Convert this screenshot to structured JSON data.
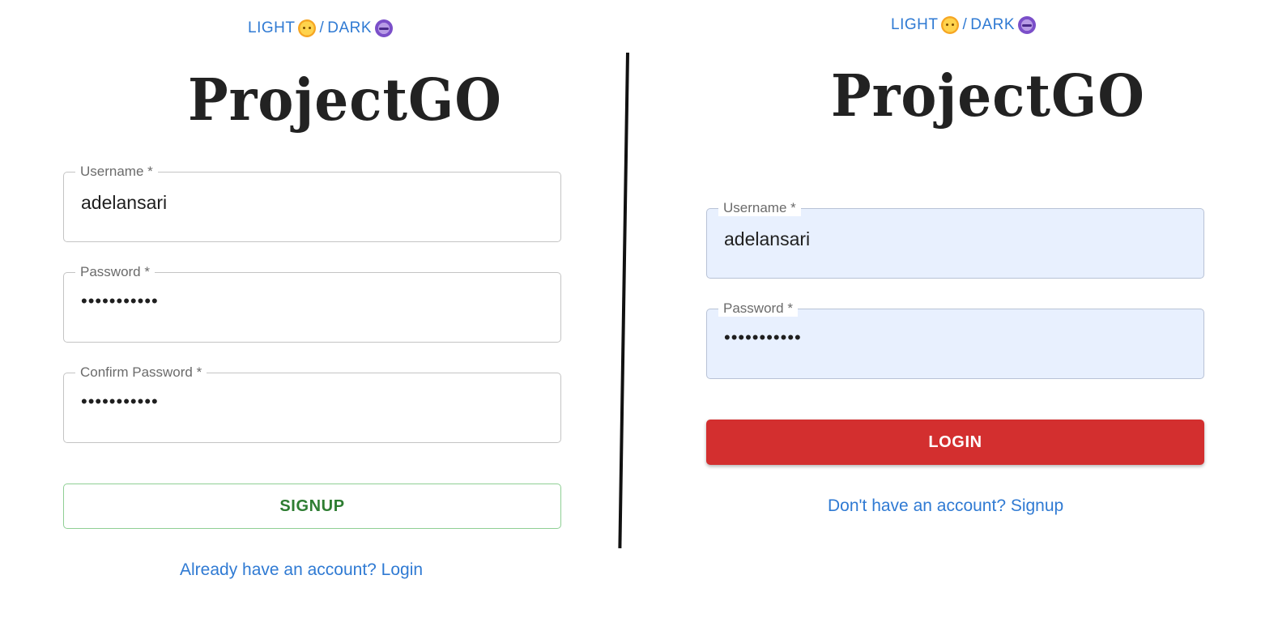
{
  "signup_panel": {
    "theme_toggle": {
      "light_label": "LIGHT",
      "separator": "/",
      "dark_label": "DARK",
      "light_icon": "sun-face-emoji",
      "dark_icon": "moon-face-emoji"
    },
    "logo": "ProjectGO",
    "username": {
      "label": "Username *",
      "value": "adelansari"
    },
    "password": {
      "label": "Password *",
      "value": "•••••••••••"
    },
    "confirm_password": {
      "label": "Confirm Password *",
      "value": "•••••••••••"
    },
    "submit_label": "SIGNUP",
    "switch_link": "Already have an account? Login"
  },
  "login_panel": {
    "theme_toggle": {
      "light_label": "LIGHT",
      "separator": "/",
      "dark_label": "DARK",
      "light_icon": "sun-face-emoji",
      "dark_icon": "moon-face-emoji"
    },
    "logo": "ProjectGO",
    "username": {
      "label": "Username *",
      "value": "adelansari"
    },
    "password": {
      "label": "Password *",
      "value": "•••••••••••"
    },
    "submit_label": "LOGIN",
    "switch_link": "Don't have an account? Signup"
  },
  "colors": {
    "link_blue": "#2f7ad3",
    "signup_green": "#2e7d32",
    "login_red": "#d32f2f",
    "autofill_bg": "#e8f0fe"
  }
}
